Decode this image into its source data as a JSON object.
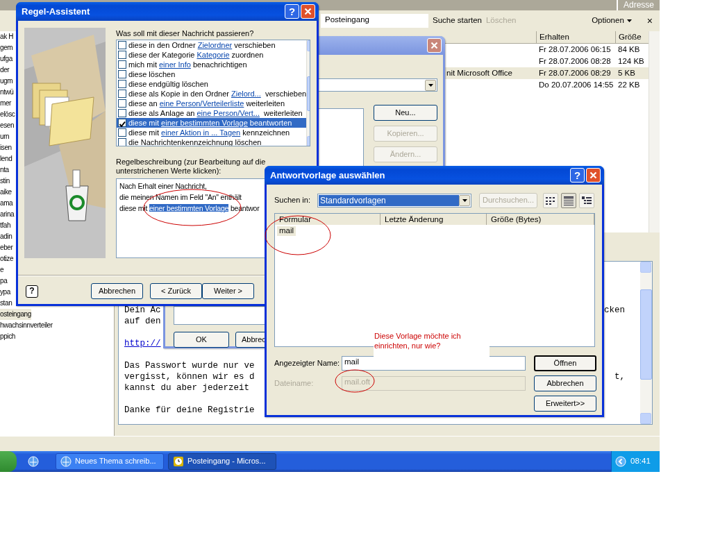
{
  "outlook": {
    "address_label": "Adresse",
    "search": {
      "folder": "Posteingang",
      "start": "Suche starten",
      "clear": "Löschen",
      "clear_disabled": true,
      "options": "Optionen",
      "close": "×"
    },
    "folders": [
      {
        "name": "ak H",
        "selected": false
      },
      {
        "name": "gem",
        "selected": false
      },
      {
        "name": "ufga",
        "selected": false
      },
      {
        "name": "der",
        "selected": false
      },
      {
        "name": "ugm",
        "selected": false
      },
      {
        "name": "ntwü",
        "selected": false
      },
      {
        "name": "mer",
        "selected": false
      },
      {
        "name": "elösc",
        "selected": false
      },
      {
        "name": "esen",
        "selected": false
      },
      {
        "name": "urn",
        "selected": false
      },
      {
        "name": "isen",
        "selected": false
      },
      {
        "name": "lend",
        "selected": false
      },
      {
        "name": "nta",
        "selected": false
      },
      {
        "name": "stin",
        "selected": false
      },
      {
        "name": "aike",
        "selected": false
      },
      {
        "name": "ama",
        "selected": false
      },
      {
        "name": "arina",
        "selected": false
      },
      {
        "name": "tfah",
        "selected": false
      },
      {
        "name": "adin",
        "selected": false
      },
      {
        "name": "eber",
        "selected": false
      },
      {
        "name": "otize",
        "selected": false
      },
      {
        "name": "e",
        "selected": false
      },
      {
        "name": "pa",
        "selected": false
      },
      {
        "name": "ypa",
        "selected": false
      },
      {
        "name": "stan",
        "selected": false
      },
      {
        "name": "osteingang",
        "selected": true
      },
      {
        "name": "hwachsinnverteiler",
        "selected": false
      },
      {
        "name": "ppich",
        "selected": false
      }
    ],
    "message_list": {
      "columns": [
        "Erhalten",
        "Größe"
      ],
      "rows": [
        {
          "received": "Fr 28.07.2006 06:15",
          "size": "84 KB",
          "selected": false
        },
        {
          "received": "Fr 28.07.2006 08:28",
          "size": "124 KB",
          "selected": false
        },
        {
          "subject": "nit Microsoft Office",
          "received": "Fr 28.07.2006 08:29",
          "size": "5 KB",
          "selected": true
        },
        {
          "received": "Do 20.07.2006 14:55",
          "size": "22 KB",
          "selected": false
        }
      ]
    },
    "reading_pane": {
      "lines": [
        {
          "kind": "text",
          "left": "Dein Ac",
          "right": "cken"
        },
        {
          "kind": "text",
          "left": "auf den"
        },
        {
          "kind": "blank"
        },
        {
          "kind": "link",
          "left": "http://"
        },
        {
          "kind": "blank"
        },
        {
          "kind": "text",
          "left": "Das Passwort wurde nur ve"
        },
        {
          "kind": "text",
          "left": "vergisst, können wir es d",
          "right": "t,"
        },
        {
          "kind": "text",
          "left": "kannst du aber jederzeit"
        },
        {
          "kind": "blank"
        },
        {
          "kind": "text",
          "left": "Danke für deine Registrie"
        }
      ]
    }
  },
  "taskbar": {
    "buttons": [
      {
        "label": "Neues Thema schreib...",
        "active": false
      },
      {
        "label": "Posteingang - Micros...",
        "active": true
      }
    ],
    "clock": "08:41"
  },
  "rules_dialog": {
    "buttons": [
      {
        "label": "Neu...",
        "disabled": false
      },
      {
        "label": "Kopieren...",
        "disabled": true
      },
      {
        "label": "Ändern...",
        "disabled": true
      }
    ],
    "footer_buttons": [
      "OK",
      "Abbrec"
    ]
  },
  "rules_wizard": {
    "title": "Regel-Assistent",
    "help_button": "?",
    "question": "Was soll mit dieser Nachricht passieren?",
    "actions": [
      {
        "before": "diese in den Ordner ",
        "link": "Zielordner",
        "after": " verschieben",
        "checked": false,
        "selected": false
      },
      {
        "before": "diese der Kategorie ",
        "link": "Kategorie",
        "after": " zuordnen",
        "checked": false,
        "selected": false
      },
      {
        "before": "mich mit ",
        "link": "einer Info",
        "after": " benachrichtigen",
        "checked": false,
        "selected": false
      },
      {
        "before": "diese löschen",
        "checked": false,
        "selected": false
      },
      {
        "before": "diese endgültig löschen",
        "checked": false,
        "selected": false
      },
      {
        "before": "diese als Kopie in den Ordner ",
        "link": "Zielord...",
        "after": "  verschieben",
        "checked": false,
        "selected": false
      },
      {
        "before": "diese an ",
        "link": "eine Person/Verteilerliste",
        "after": " weiterleiten",
        "checked": false,
        "selected": false
      },
      {
        "before": "diese als Anlage an ",
        "link": "eine Person/Vert...",
        "after": "  weiterleiten",
        "checked": false,
        "selected": false
      },
      {
        "before": "diese mit ",
        "link": "einer bestimmten Vorlage",
        "after": " beantworten",
        "checked": true,
        "selected": true
      },
      {
        "before": "diese mit ",
        "link": "einer Aktion in ... Tagen",
        "after": " kennzeichnen",
        "checked": false,
        "selected": false
      },
      {
        "before": "die Nachrichtenkennzeichnung löschen",
        "checked": false,
        "selected": false
      }
    ],
    "description_label": "Regelbeschreibung (zur Bearbeitung auf die unterstrichenen Werte klicken):",
    "description": [
      {
        "before": "Nach Erhalt einer Nachricht,"
      },
      {
        "before": "die meinen Namen im Feld \"An\" enthält"
      },
      {
        "before": "diese mit ",
        "link": "einer bestimmten Vorlage",
        "after": " beantwor",
        "link_selected": true
      }
    ],
    "footer_help": "?",
    "buttons": [
      "Abbrechen",
      "< Zurück",
      "Weiter >"
    ]
  },
  "template_dialog": {
    "title": "Antwortvorlage auswählen",
    "help_button": "?",
    "look_in_label": "Suchen in:",
    "look_in": "Standardvorlagen",
    "browse": {
      "label": "Durchsuchen...",
      "disabled": true
    },
    "views": [
      {
        "kind": "list",
        "selected": false
      },
      {
        "kind": "details",
        "selected": true
      },
      {
        "kind": "properties",
        "selected": false
      }
    ],
    "columns": [
      "Formular",
      "Letzte Änderung",
      "Größe (Bytes)"
    ],
    "rows": [
      {
        "name": "mail",
        "selected": true
      }
    ],
    "display_name_label": "Angezeigter Name:",
    "display_name": "mail",
    "file_name_label": "Dateiname:",
    "file_name": "mail.oft",
    "file_name_disabled": true,
    "buttons": [
      {
        "label": "Öffnen",
        "default": true
      },
      {
        "label": "Abbrechen",
        "default": false
      },
      {
        "label": "Erweitert>>",
        "default": false
      }
    ]
  },
  "annotation": {
    "note": "Diese Vorlage möchte ich einrichten, nur wie?"
  }
}
